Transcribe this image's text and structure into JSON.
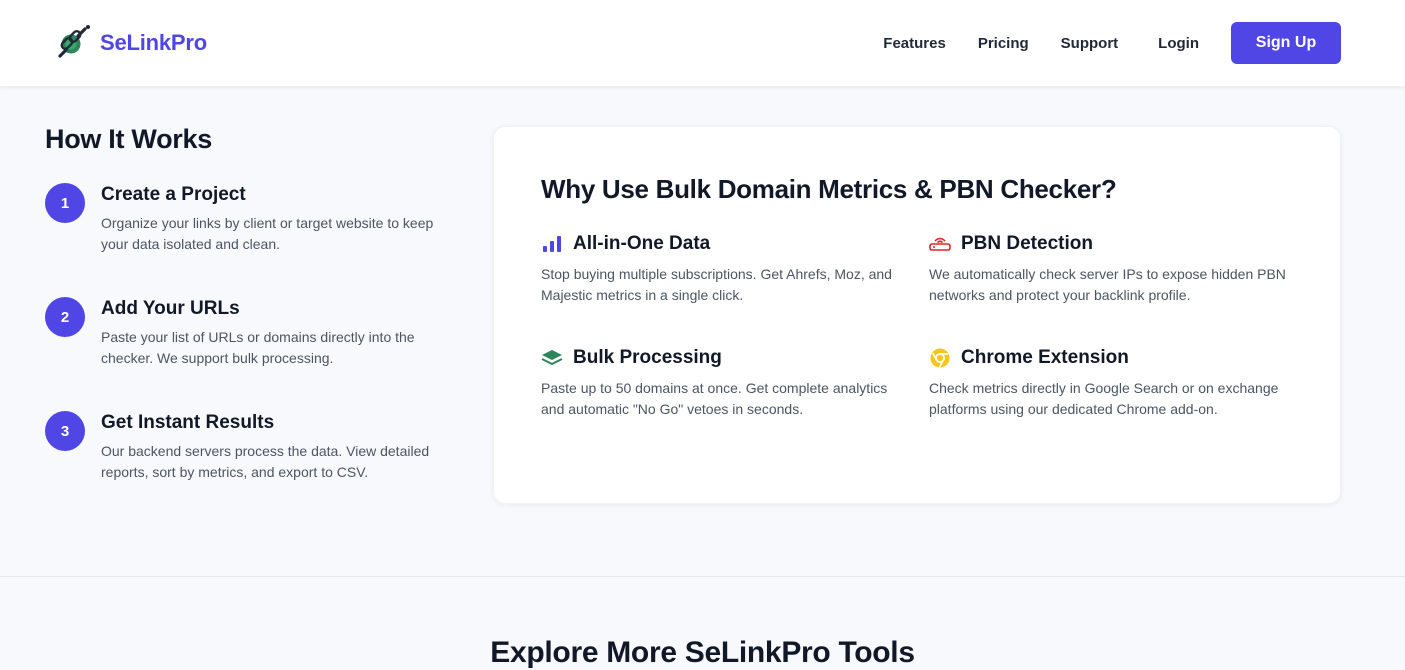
{
  "brand": {
    "name": "SeLinkPro",
    "accent": "#4f46e5"
  },
  "nav": {
    "items": [
      "Features",
      "Pricing",
      "Support"
    ],
    "login_label": "Login",
    "signup_label": "Sign Up"
  },
  "how_it_works": {
    "title": "How It Works",
    "steps": [
      {
        "number": "1",
        "title": "Create a Project",
        "description": "Organize your links by client or target website to keep your data isolated and clean."
      },
      {
        "number": "2",
        "title": "Add Your URLs",
        "description": "Paste your list of URLs or domains directly into the checker. We support bulk processing."
      },
      {
        "number": "3",
        "title": "Get Instant Results",
        "description": "Our backend servers process the data. View detailed reports, sort by metrics, and export to CSV."
      }
    ]
  },
  "why_card": {
    "title": "Why Use Bulk Domain Metrics & PBN Checker?",
    "features": [
      {
        "icon": "bar-chart-icon",
        "title": "All-in-One Data",
        "description": "Stop buying multiple subscriptions. Get Ahrefs, Moz, and Majestic metrics in a single click."
      },
      {
        "icon": "server-network-icon",
        "title": "PBN Detection",
        "description": "We automatically check server IPs to expose hidden PBN networks and protect your backlink profile."
      },
      {
        "icon": "layers-icon",
        "title": "Bulk Processing",
        "description": "Paste up to 50 domains at once. Get complete analytics and automatic \"No Go\" vetoes in seconds."
      },
      {
        "icon": "chrome-icon",
        "title": "Chrome Extension",
        "description": "Check metrics directly in Google Search or on exchange platforms using our dedicated Chrome add-on."
      }
    ]
  },
  "explore": {
    "title": "Explore More SeLinkPro Tools"
  }
}
